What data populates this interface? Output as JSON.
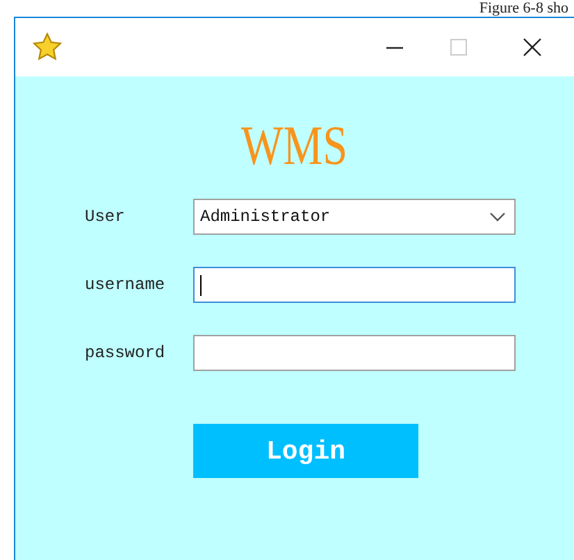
{
  "caption": "Figure 6-8 sho",
  "heading": "WMS",
  "fields": [
    {
      "kind": "dropdown",
      "label": "User",
      "value": "Administrator",
      "focused": false
    },
    {
      "kind": "text",
      "label": "username",
      "focused": true
    },
    {
      "kind": "text",
      "label": "password",
      "focused": false
    }
  ],
  "button": "Login"
}
